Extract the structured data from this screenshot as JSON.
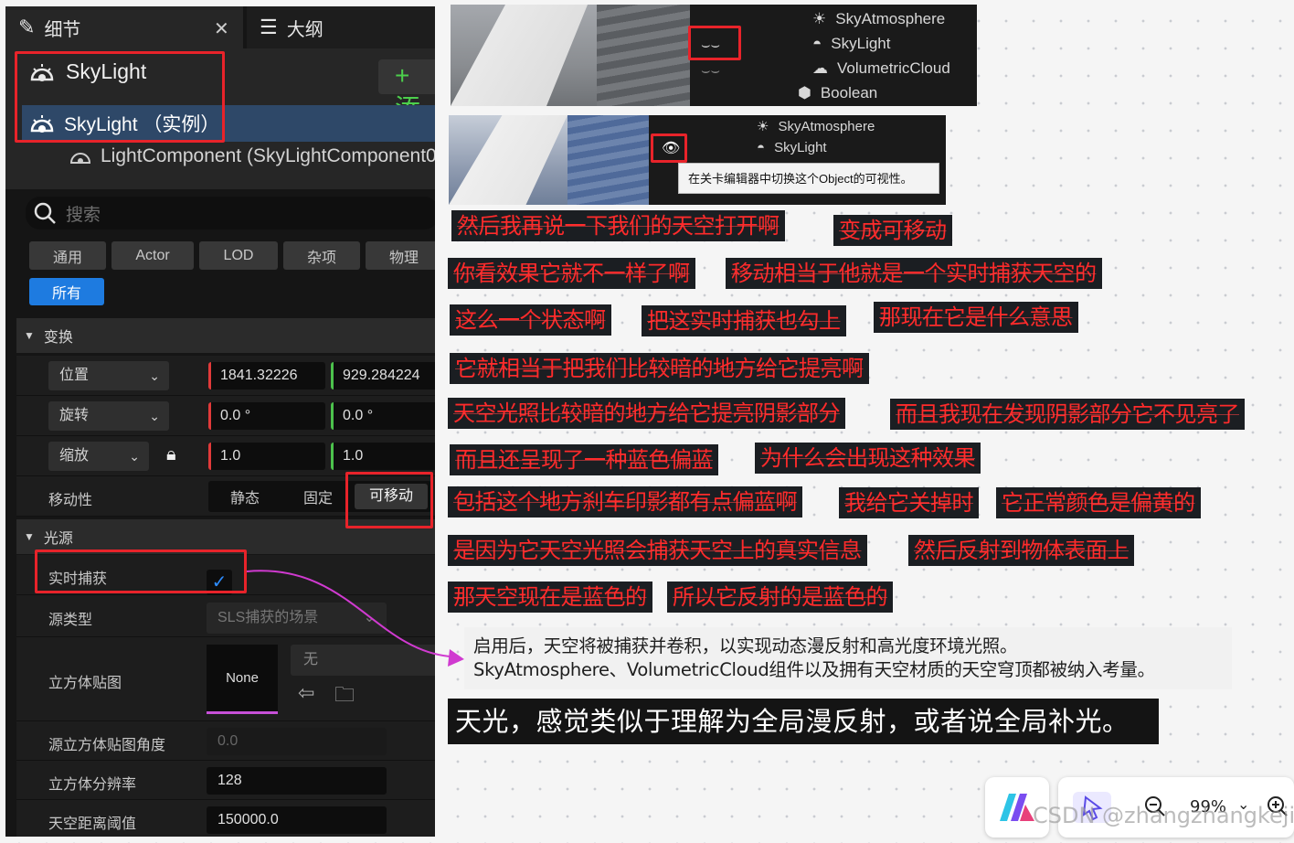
{
  "details_panel": {
    "tab_details": "细节",
    "tab_outline": "大纲",
    "actor_title": "SkyLight",
    "add_button": "+ 添",
    "instance_row": "SkyLight （实例）",
    "component_row": "LightComponent (SkyLightComponent0",
    "search_placeholder": "搜索",
    "filters": [
      "通用",
      "Actor",
      "LOD",
      "杂项",
      "物理",
      "所有"
    ],
    "section_transform": "变换",
    "location": {
      "label": "位置",
      "x": "1841.32226",
      "y": "929.284224"
    },
    "rotation": {
      "label": "旋转",
      "x": "0.0 °",
      "y": "0.0 °"
    },
    "scale": {
      "label": "缩放",
      "x": "1.0",
      "y": "1.0"
    },
    "mobility": {
      "label": "移动性",
      "options": [
        "静态",
        "固定",
        "可移动"
      ],
      "selected": "可移动"
    },
    "section_light": "光源",
    "realtime_capture": {
      "label": "实时捕获",
      "checked": true
    },
    "source_type": {
      "label": "源类型",
      "value": "SLS捕获的场景"
    },
    "cubemap": {
      "label": "立方体贴图",
      "thumb": "None",
      "value": "无"
    },
    "cubemap_angle": {
      "label": "源立方体贴图角度",
      "value": "0.0"
    },
    "cubemap_resolution": {
      "label": "立方体分辨率",
      "value": "128"
    },
    "sky_distance": {
      "label": "天空距离阈值",
      "value": "150000.0"
    }
  },
  "outliner1": {
    "items": [
      "SkyAtmosphere",
      "SkyLight",
      "VolumetricCloud",
      "Boolean"
    ]
  },
  "outliner2": {
    "items": [
      "SkyAtmosphere",
      "SkyLight"
    ],
    "tooltip": "在关卡编辑器中切换这个Object的可视性。"
  },
  "subtitles": [
    "然后我再说一下我们的天空打开啊",
    "变成可移动",
    "你看效果它就不一样了啊",
    "移动相当于他就是一个实时捕获天空的",
    "这么一个状态啊",
    "把这实时捕获也勾上",
    "那现在它是什么意思",
    "它就相当于把我们比较暗的地方给它提亮啊",
    "天空光照比较暗的地方给它提亮阴影部分",
    "而且我现在发现阴影部分它不见亮了",
    "而且还呈现了一种蓝色偏蓝",
    "为什么会出现这种效果",
    "包括这个地方刹车印影都有点偏蓝啊",
    "我给它关掉时",
    "它正常颜色是偏黄的",
    "是因为它天空光照会捕获天空上的真实信息",
    "然后反射到物体表面上",
    "那天空现在是蓝色的",
    "所以它反射的是蓝色的"
  ],
  "note": {
    "line1": "启用后，天空将被捕获并卷积，以实现动态漫反射和高光度环境光照。",
    "line2": "SkyAtmosphere、VolumetricCloud组件以及拥有天空材质的天空穹顶都被纳入考量。"
  },
  "caption": "天光，感觉类似于理解为全局漫反射，或者说全局补光。",
  "toolbar": {
    "zoom": "99%"
  },
  "watermark": "CSDN @zhangzhangkeji",
  "colors": {
    "annotation_red": "#e8232a",
    "arrow_magenta": "#d03ad0",
    "selection_blue": "#2e4868",
    "accent_blue": "#1e7be0"
  }
}
